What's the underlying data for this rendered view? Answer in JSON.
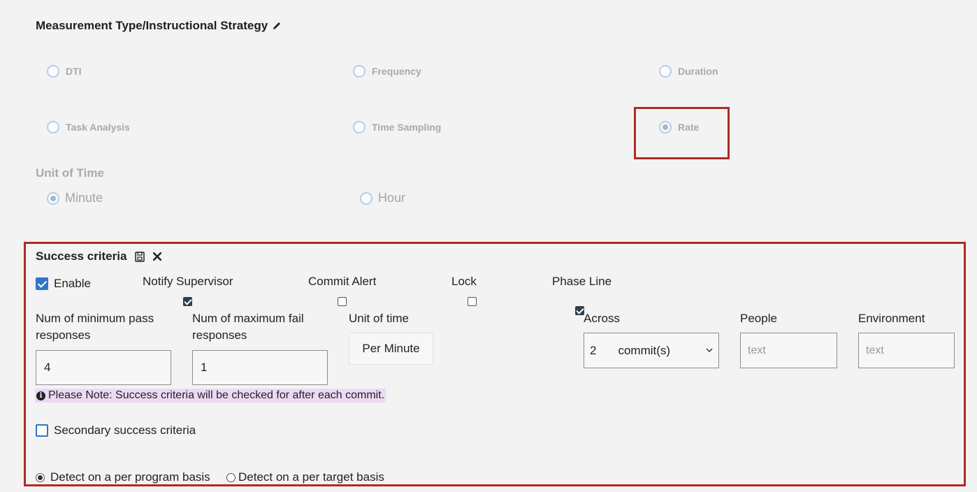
{
  "measurement": {
    "title": "Measurement Type/Instructional Strategy",
    "options": [
      {
        "label": "DTI",
        "selected": false
      },
      {
        "label": "Frequency",
        "selected": false
      },
      {
        "label": "Duration",
        "selected": false
      },
      {
        "label": "Task Analysis",
        "selected": false
      },
      {
        "label": "Time Sampling",
        "selected": false
      },
      {
        "label": "Rate",
        "selected": true
      }
    ]
  },
  "unit_of_time": {
    "title": "Unit of Time",
    "options": [
      {
        "label": "Minute",
        "selected": true
      },
      {
        "label": "Hour",
        "selected": false
      }
    ]
  },
  "success": {
    "title": "Success criteria",
    "enable_label": "Enable",
    "enable_checked": true,
    "notify_supervisor_label": "Notify Supervisor",
    "notify_supervisor_checked": true,
    "commit_alert_label": "Commit Alert",
    "commit_alert_checked": false,
    "lock_label": "Lock",
    "lock_checked": false,
    "phase_line_label": "Phase Line",
    "phase_line_checked": true,
    "min_pass_label_1": "Num of minimum pass",
    "min_pass_label_2": "responses",
    "min_pass_value": "4",
    "max_fail_label_1": "Num of maximum fail",
    "max_fail_label_2": "responses",
    "max_fail_value": "1",
    "unit_label": "Unit of time",
    "unit_value": "Per Minute",
    "across_label": "Across",
    "across_value": "2",
    "across_unit": "commit(s)",
    "people_label": "People",
    "people_placeholder": "text",
    "environment_label": "Environment",
    "environment_placeholder": "text",
    "note": "Please Note: Success criteria will be checked for after each commit.",
    "secondary_label": "Secondary success criteria",
    "secondary_checked": false,
    "detect_program_label": "Detect on a per program basis",
    "detect_target_label": "Detect on a per target basis",
    "detect_selected": "program"
  },
  "colors": {
    "highlight_border": "#b02a24",
    "checkbox_blue": "#2f75c8",
    "note_bg": "#ecd9f5"
  }
}
